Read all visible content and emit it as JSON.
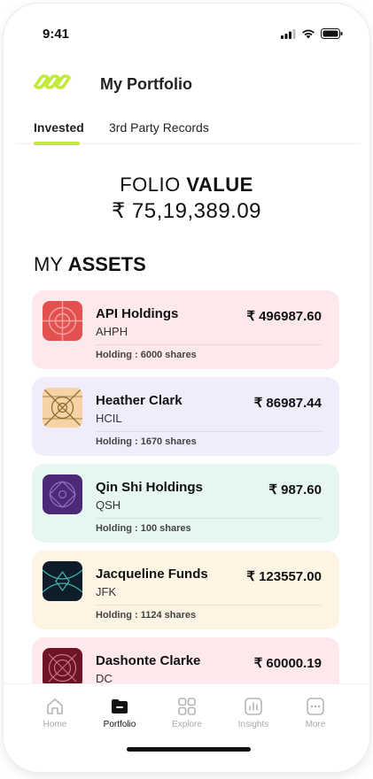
{
  "status": {
    "time": "9:41"
  },
  "header": {
    "title": "My Portfolio"
  },
  "tabs": [
    {
      "label": "Invested",
      "active": true
    },
    {
      "label": "3rd Party Records",
      "active": false
    }
  ],
  "folio": {
    "label_prefix": "FOLIO",
    "label_emphasis": "VALUE",
    "value": "₹ 75,19,389.09"
  },
  "assets_title": {
    "prefix": "MY",
    "emphasis": "ASSETS"
  },
  "assets": [
    {
      "name": "API Holdings",
      "ticker": "AHPH",
      "price": "₹ 496987.60",
      "holding": "Holding : 6000 shares",
      "bg": "#fde8ec",
      "icon_color": "#e2504f"
    },
    {
      "name": "Heather Clark",
      "ticker": "HCIL",
      "price": "₹ 86987.44",
      "holding": "Holding : 1670 shares",
      "bg": "#f0ecfb",
      "icon_color": "#f6d2a6"
    },
    {
      "name": "Qin Shi Holdings",
      "ticker": "QSH",
      "price": "₹ 987.60",
      "holding": "Holding : 100 shares",
      "bg": "#e6f7f0",
      "icon_color": "#4b2a78"
    },
    {
      "name": "Jacqueline Funds",
      "ticker": "JFK",
      "price": "₹ 123557.00",
      "holding": "Holding : 1124 shares",
      "bg": "#fdf4e3",
      "icon_color": "#0f1c2a"
    },
    {
      "name": "Dashonte Clarke",
      "ticker": "DC",
      "price": "₹ 60000.19",
      "holding": "",
      "bg": "#fde8ec",
      "icon_color": "#6e1424"
    }
  ],
  "nav": [
    {
      "label": "Home",
      "icon": "home-icon",
      "active": false
    },
    {
      "label": "Portfolio",
      "icon": "folder-icon",
      "active": true
    },
    {
      "label": "Explore",
      "icon": "grid-icon",
      "active": false
    },
    {
      "label": "Insights",
      "icon": "chart-icon",
      "active": false
    },
    {
      "label": "More",
      "icon": "more-icon",
      "active": false
    }
  ],
  "colors": {
    "accent": "#c2ea3b",
    "text": "#111111"
  }
}
